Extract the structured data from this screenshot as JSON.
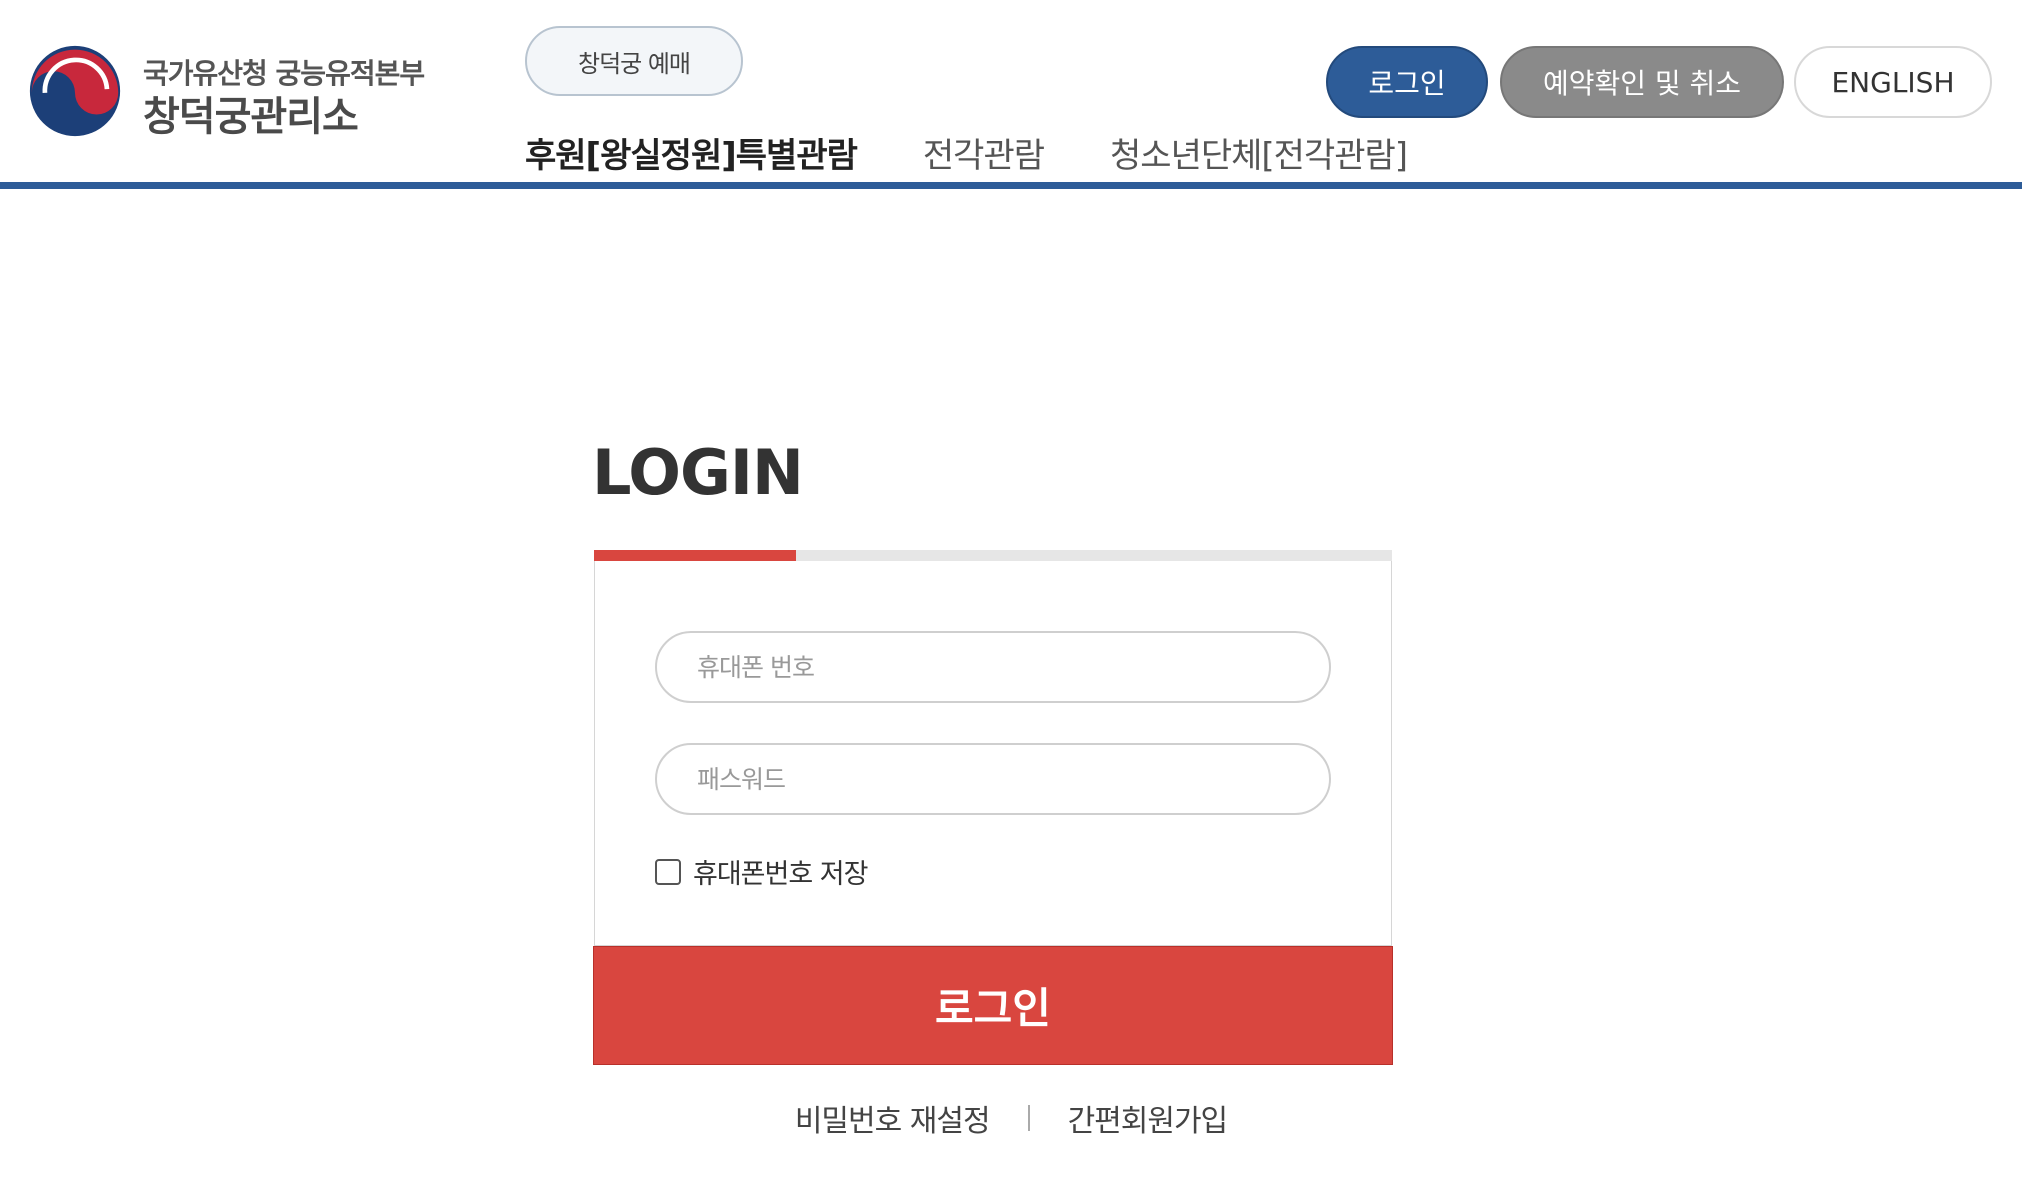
{
  "header": {
    "org_line1": "국가유산청 궁능유적본부",
    "org_line2": "창덕궁관리소",
    "booking_button": "창덕궁 예매",
    "login_button": "로그인",
    "reservation_button": "예약확인 및 취소",
    "english_button": "ENGLISH",
    "nav": [
      {
        "label": "후원[왕실정원]특별관람",
        "active": true
      },
      {
        "label": "전각관람",
        "active": false
      },
      {
        "label": "청소년단체[전각관람]",
        "active": false
      }
    ]
  },
  "login": {
    "title": "LOGIN",
    "phone_placeholder": "휴대폰 번호",
    "password_placeholder": "패스워드",
    "remember_label": "휴대폰번호 저장",
    "remember_checked": false,
    "submit_label": "로그인",
    "reset_password_link": "비밀번호 재설정",
    "signup_link": "간편회원가입"
  },
  "colors": {
    "brand_blue": "#2d5c98",
    "accent_red": "#d9463f",
    "gray_button": "#8a8a8a"
  },
  "icons": [
    "government-emblem-icon",
    "checkbox-icon"
  ]
}
